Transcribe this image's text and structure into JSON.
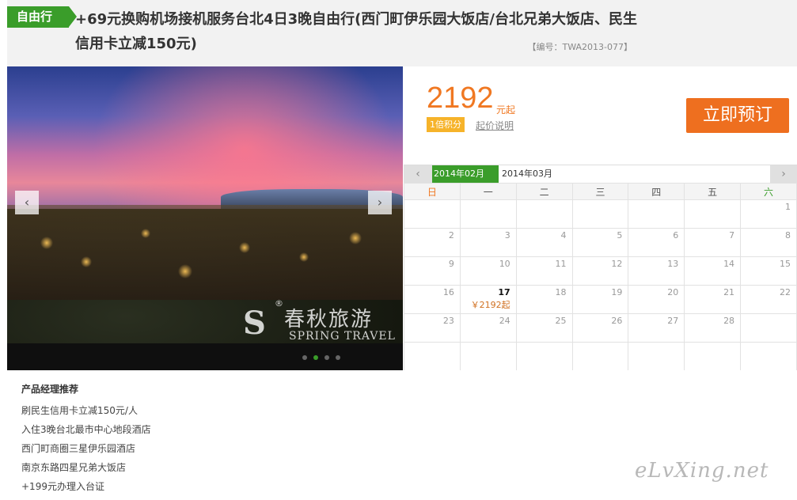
{
  "header": {
    "tag": "自由行",
    "title": "+69元换购机场接机服务台北4日3晚自由行(西门町伊乐园大饭店/台北兄弟大饭店、民生信用卡立减150元)",
    "code": "【编号：TWA2013-077】"
  },
  "slider": {
    "prev_icon": "‹",
    "next_icon": "›",
    "watermark_logo": "S",
    "watermark_cn": "春秋旅游",
    "watermark_en": "SPRING TRAVEL",
    "watermark_reg": "®",
    "dot_count": 4,
    "active_dot": 1
  },
  "price": {
    "amount": "2192",
    "unit": "元起",
    "points_badge": "1倍积分",
    "note_link": "起价说明",
    "book_button": "立即预订"
  },
  "calendar": {
    "prev_icon": "‹",
    "next_icon": "›",
    "months": [
      {
        "label": "2014年02月",
        "active": true
      },
      {
        "label": "2014年03月",
        "active": false
      }
    ],
    "weekdays": [
      "日",
      "一",
      "二",
      "三",
      "四",
      "五",
      "六"
    ],
    "weeks": [
      [
        "",
        "",
        "",
        "",
        "",
        "",
        "1"
      ],
      [
        "2",
        "3",
        "4",
        "5",
        "6",
        "7",
        "8"
      ],
      [
        "9",
        "10",
        "11",
        "12",
        "13",
        "14",
        "15"
      ],
      [
        "16",
        "17",
        "18",
        "19",
        "20",
        "21",
        "22"
      ],
      [
        "23",
        "24",
        "25",
        "26",
        "27",
        "28",
        ""
      ],
      [
        "",
        "",
        "",
        "",
        "",
        "",
        ""
      ]
    ],
    "priced_days": {
      "17": "￥2192起"
    }
  },
  "recommend": {
    "title": "产品经理推荐",
    "items": [
      "刷民生信用卡立减150元/人",
      "入住3晚台北最市中心地段酒店",
      "西门町商圈三星伊乐园酒店",
      "南京东路四星兄弟大饭店",
      "+199元办理入台证"
    ]
  },
  "site_mark": "eLvXing.net",
  "colors": {
    "accent_green": "#3a9d2a",
    "price_orange": "#f07822",
    "book_orange": "#ee6f1f",
    "points_yellow": "#f6b32a"
  }
}
